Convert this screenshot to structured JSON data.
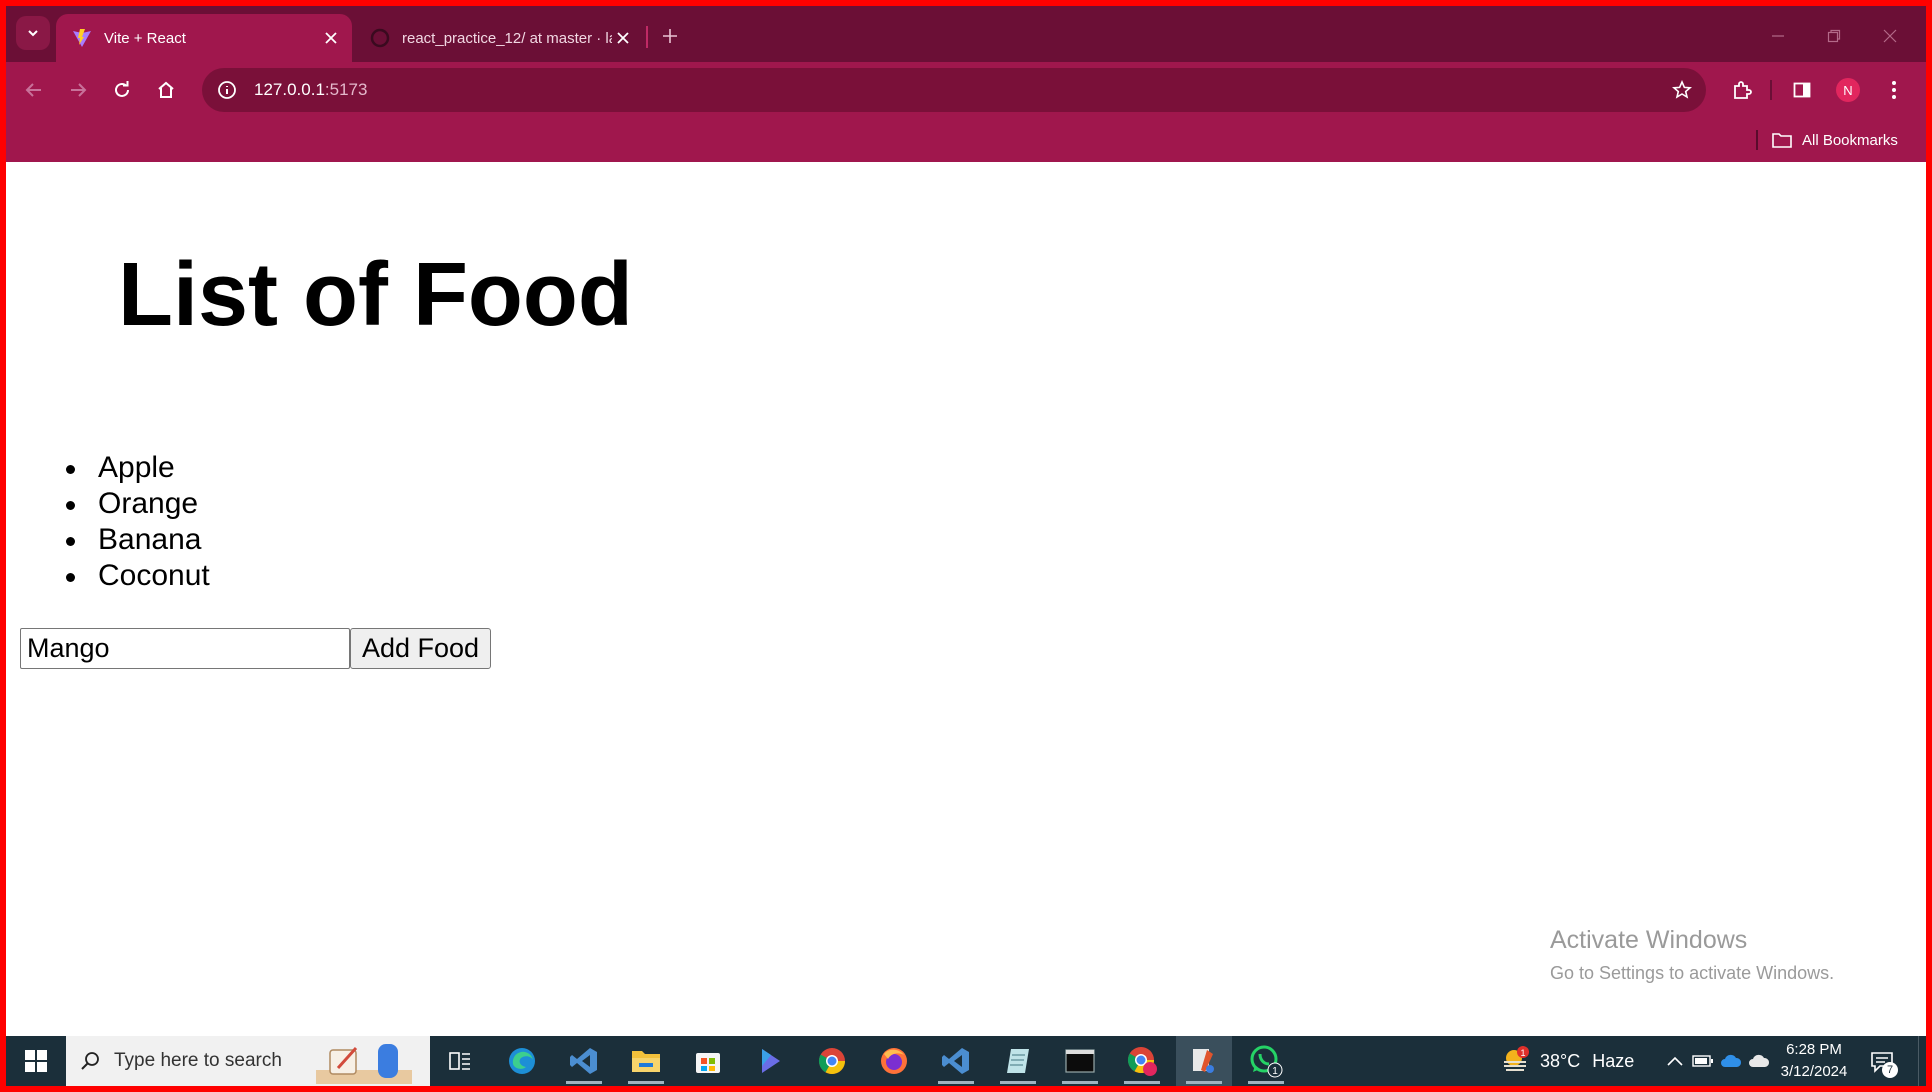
{
  "browser": {
    "tabs": [
      {
        "title": "Vite + React",
        "active": true
      },
      {
        "title": "react_practice_12/ at master · la",
        "active": false
      }
    ],
    "address": {
      "host": "127.0.0.1",
      "port": ":5173"
    },
    "bookmarks_bar": {
      "all_bookmarks_label": "All Bookmarks"
    },
    "profile_initial": "N",
    "theme_color": "#a0174d"
  },
  "page": {
    "title": "List of Food",
    "foods": [
      "Apple",
      "Orange",
      "Banana",
      "Coconut"
    ],
    "input_value": "Mango",
    "add_button_label": "Add Food"
  },
  "watermark": {
    "title": "Activate Windows",
    "subtitle": "Go to Settings to activate Windows."
  },
  "taskbar": {
    "search_placeholder": "Type here to search",
    "apps": [
      "task-view",
      "edge",
      "vscode",
      "file-explorer",
      "microsoft-store",
      "copilot",
      "chrome",
      "firefox",
      "vscode-2",
      "notepad",
      "terminal",
      "chrome-profile",
      "app-active",
      "whatsapp"
    ],
    "whatsapp_badge": "1",
    "weather": {
      "alert": "1",
      "temp": "38°C",
      "condition": "Haze"
    },
    "clock": {
      "time": "6:28 PM",
      "date": "3/12/2024"
    },
    "notifications_count": "7"
  }
}
